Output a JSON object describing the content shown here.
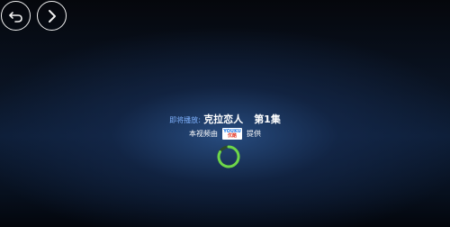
{
  "nav": {
    "back_icon": "back-arrow-icon",
    "forward_icon": "chevron-right-icon"
  },
  "player": {
    "up_next_label": "即将播放",
    "separator": ":",
    "title": "克拉恋人",
    "episode": "第1集",
    "provided_by_prefix": "本视频由",
    "provider_logo_top": "YOUKU",
    "provider_logo_bottom": "优酷",
    "provided_by_suffix": "提供"
  },
  "colors": {
    "accent_label": "#7fb2ff",
    "spinner_green": "#6dd64a",
    "spinner_dim": "#2d4a2a"
  }
}
